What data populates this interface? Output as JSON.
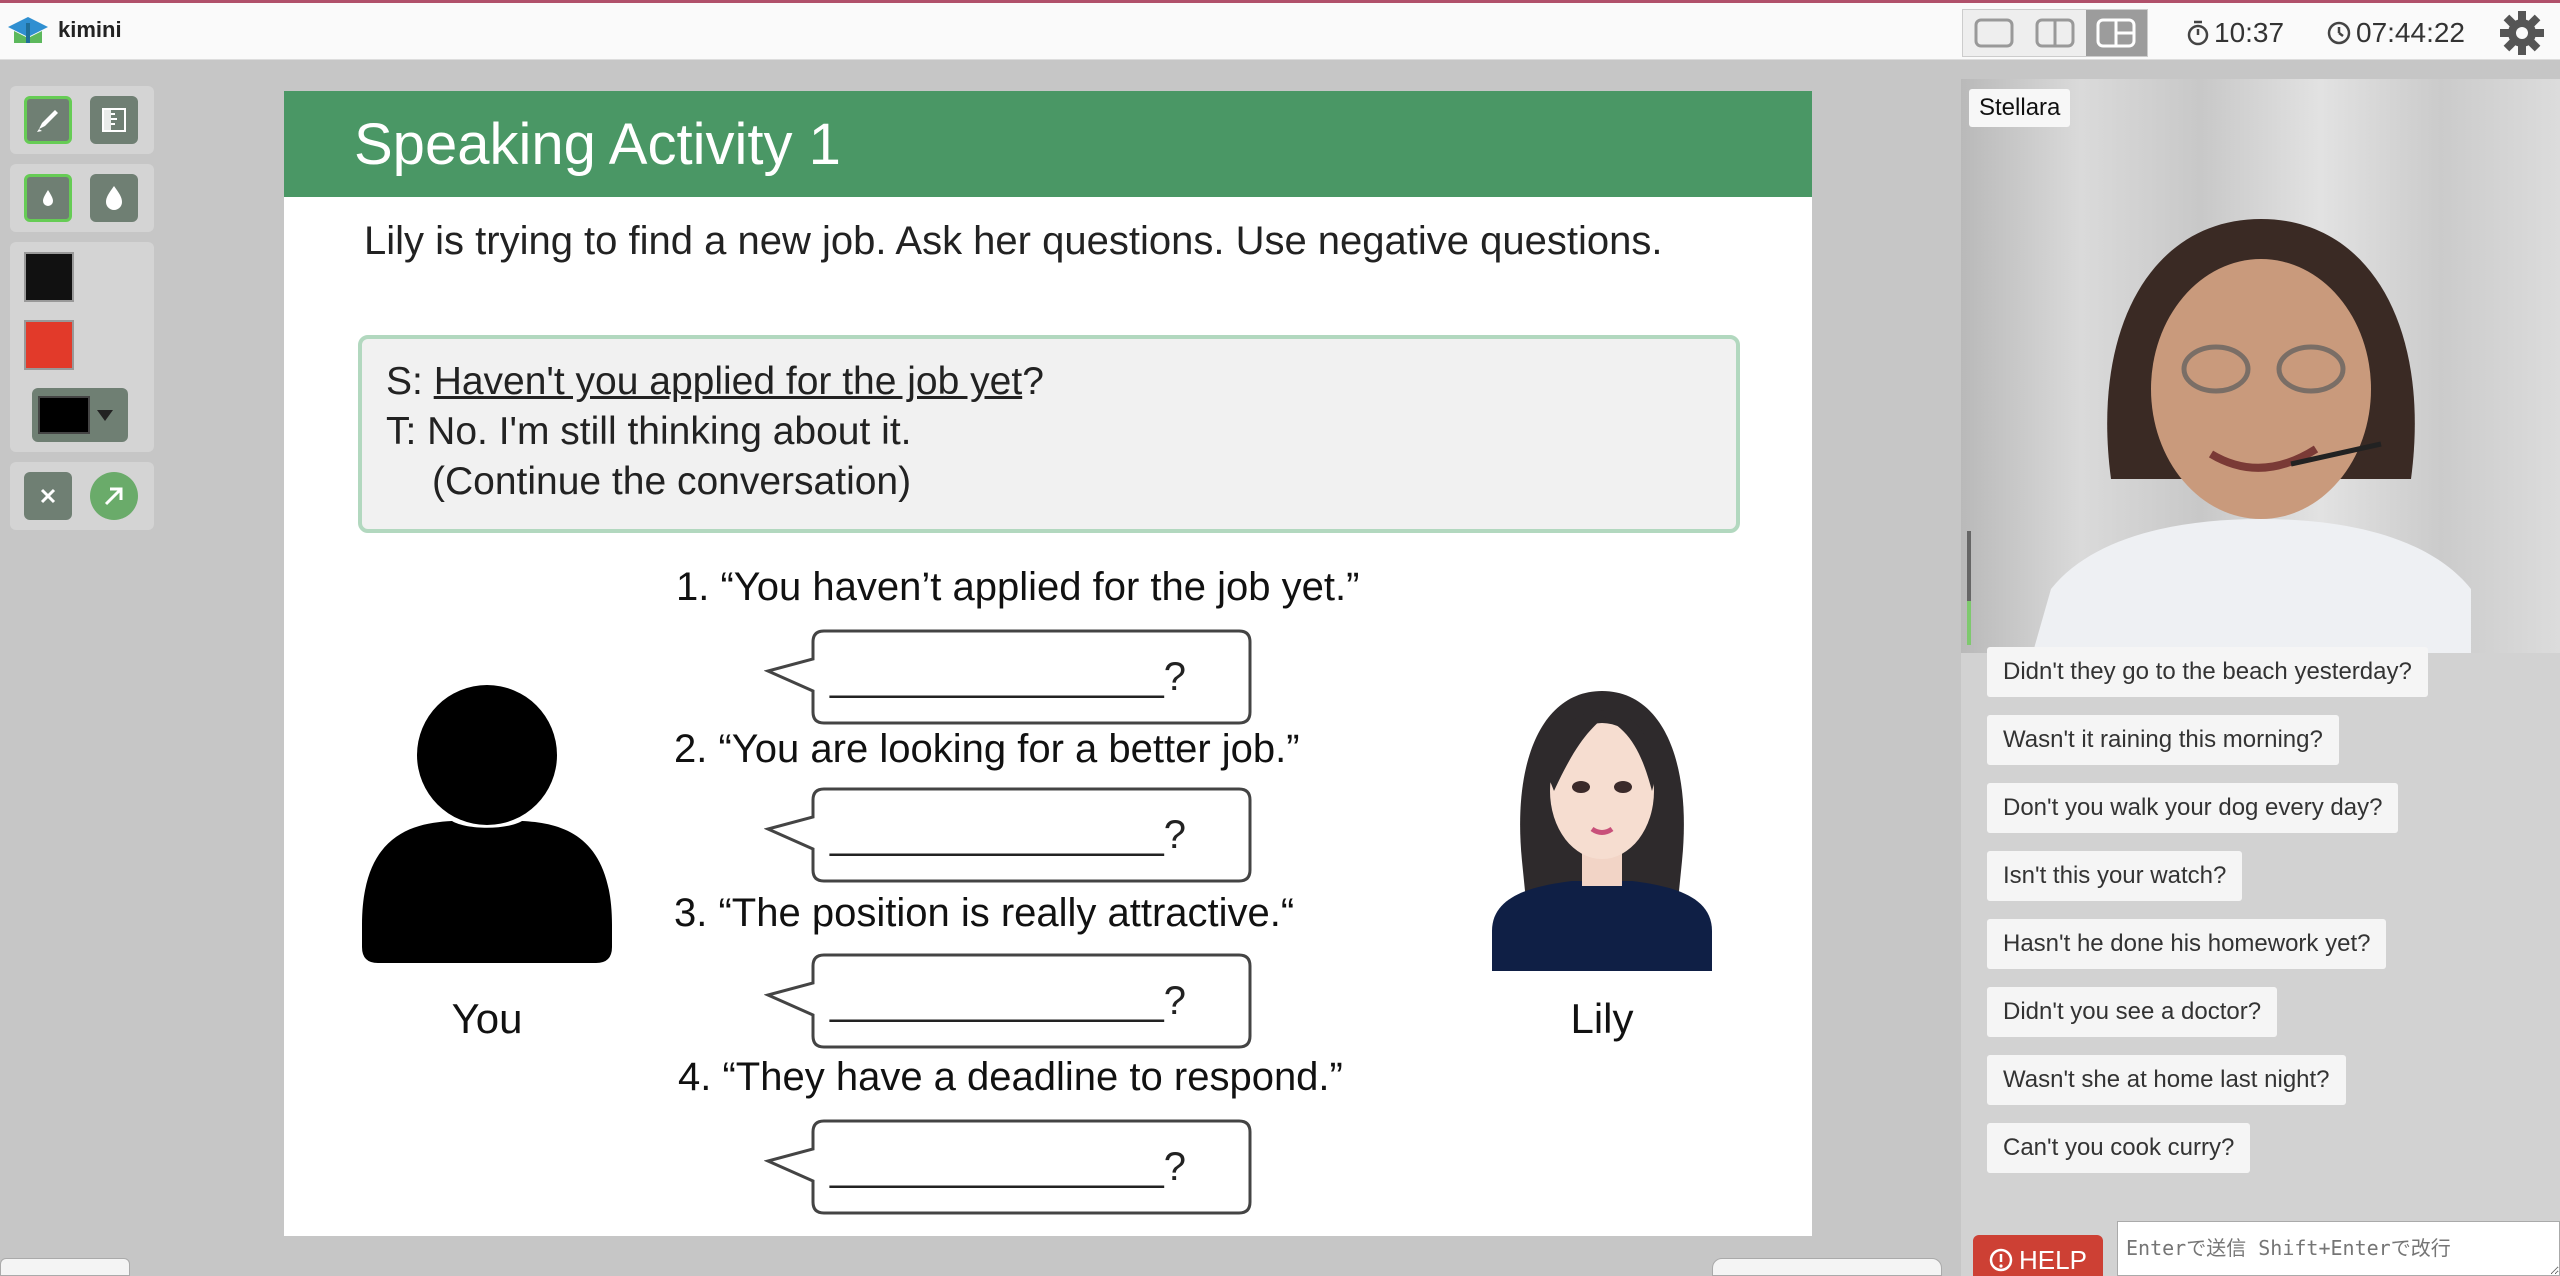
{
  "app": {
    "name": "kimini"
  },
  "timers": {
    "elapsed": "10:37",
    "clock": "07:44:22"
  },
  "slide": {
    "title": "Speaking Activity 1",
    "instruction": "Lily is trying to find a new job. Ask her questions. Use negative questions.",
    "example": {
      "s_prefix": "S: ",
      "s_underlined": "Haven't you applied for the job yet",
      "s_suffix": "?",
      "t_line": "T: No. I'm still thinking about it.",
      "continue": "(Continue the conversation)"
    },
    "questions": [
      {
        "text": "1. “You haven’t applied for the job yet.”"
      },
      {
        "text": "2. “You are looking for a better job.”"
      },
      {
        "text": "3. “The position is really attractive.“"
      },
      {
        "text": "4. “They have a deadline to respond.”"
      }
    ],
    "bubble_text": "_______________?",
    "you_label": "You",
    "lily_label": "Lily"
  },
  "video": {
    "name": "Stellara"
  },
  "chat": {
    "messages": [
      "Didn't they go to the beach yesterday?",
      "Wasn't it raining this morning?",
      "Don't you walk your dog every day?",
      "Isn't this your watch?",
      "Hasn't he done his homework yet?",
      "Didn't you see a doctor?",
      "Wasn't she at home last night?",
      "Can't you cook curry?"
    ],
    "help_label": "HELP",
    "input_placeholder": "Enterで送信 Shift+Enterで改行"
  },
  "colors": {
    "header_green": "#4a9765",
    "help_red": "#cd4034",
    "swatch_black": "#111111",
    "swatch_red": "#e23a2a"
  },
  "icons": [
    "pen-icon",
    "ruler-icon",
    "small-drop-icon",
    "large-drop-icon",
    "chevron-down-icon",
    "clear-icon",
    "pointer-arrow-icon",
    "timer-icon",
    "clock-icon",
    "gear-icon",
    "help-icon"
  ]
}
